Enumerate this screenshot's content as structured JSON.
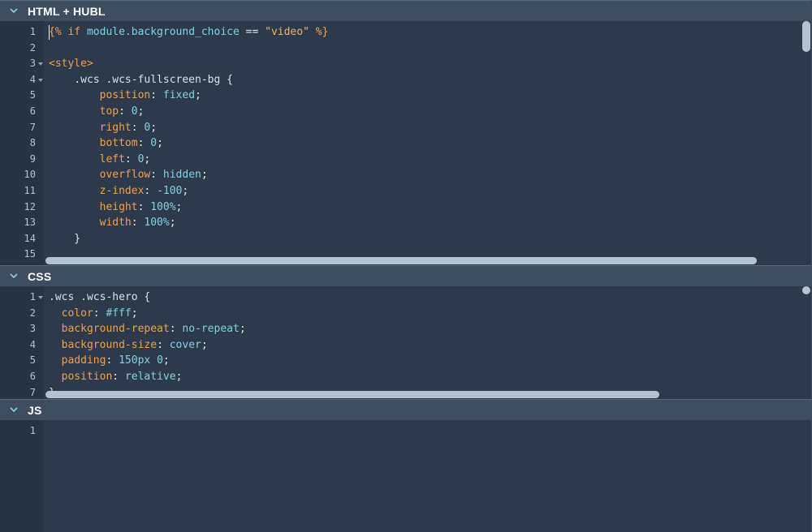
{
  "panels": {
    "html": {
      "title": "HTML + HUBL",
      "lines": [
        {
          "n": "1",
          "tokens": [
            [
              "t-hubl",
              "{% "
            ],
            [
              "t-kw",
              "if "
            ],
            [
              "t-var",
              "module.background_choice "
            ],
            [
              "t-punc",
              "== "
            ],
            [
              "t-str",
              "\"video\" "
            ],
            [
              "t-hubl",
              "%}"
            ]
          ]
        },
        {
          "n": "2",
          "tokens": []
        },
        {
          "n": "3",
          "fold": true,
          "tokens": [
            [
              "t-tag",
              "<style>"
            ]
          ]
        },
        {
          "n": "4",
          "fold": true,
          "tokens": [
            [
              "t-sel",
              "    .wcs .wcs-fullscreen-bg "
            ],
            [
              "t-punc",
              "{"
            ]
          ]
        },
        {
          "n": "5",
          "tokens": [
            [
              "t-prop",
              "        position"
            ],
            [
              "t-punc",
              ": "
            ],
            [
              "t-val",
              "fixed"
            ],
            [
              "t-punc",
              ";"
            ]
          ]
        },
        {
          "n": "6",
          "tokens": [
            [
              "t-prop",
              "        top"
            ],
            [
              "t-punc",
              ": "
            ],
            [
              "t-val",
              "0"
            ],
            [
              "t-punc",
              ";"
            ]
          ]
        },
        {
          "n": "7",
          "tokens": [
            [
              "t-prop",
              "        right"
            ],
            [
              "t-punc",
              ": "
            ],
            [
              "t-val",
              "0"
            ],
            [
              "t-punc",
              ";"
            ]
          ]
        },
        {
          "n": "8",
          "tokens": [
            [
              "t-prop",
              "        bottom"
            ],
            [
              "t-punc",
              ": "
            ],
            [
              "t-val",
              "0"
            ],
            [
              "t-punc",
              ";"
            ]
          ]
        },
        {
          "n": "9",
          "tokens": [
            [
              "t-prop",
              "        left"
            ],
            [
              "t-punc",
              ": "
            ],
            [
              "t-val",
              "0"
            ],
            [
              "t-punc",
              ";"
            ]
          ]
        },
        {
          "n": "10",
          "tokens": [
            [
              "t-prop",
              "        overflow"
            ],
            [
              "t-punc",
              ": "
            ],
            [
              "t-val",
              "hidden"
            ],
            [
              "t-punc",
              ";"
            ]
          ]
        },
        {
          "n": "11",
          "tokens": [
            [
              "t-prop",
              "        z-index"
            ],
            [
              "t-punc",
              ": "
            ],
            [
              "t-val",
              "-100"
            ],
            [
              "t-punc",
              ";"
            ]
          ]
        },
        {
          "n": "12",
          "tokens": [
            [
              "t-prop",
              "        height"
            ],
            [
              "t-punc",
              ": "
            ],
            [
              "t-val",
              "100%"
            ],
            [
              "t-punc",
              ";"
            ]
          ]
        },
        {
          "n": "13",
          "tokens": [
            [
              "t-prop",
              "        width"
            ],
            [
              "t-punc",
              ": "
            ],
            [
              "t-val",
              "100%"
            ],
            [
              "t-punc",
              ";"
            ]
          ]
        },
        {
          "n": "14",
          "tokens": [
            [
              "t-punc",
              "    }"
            ]
          ]
        },
        {
          "n": "15",
          "tokens": []
        }
      ]
    },
    "css": {
      "title": "CSS",
      "lines": [
        {
          "n": "1",
          "fold": true,
          "tokens": [
            [
              "t-sel",
              ".wcs .wcs-hero "
            ],
            [
              "t-punc",
              "{"
            ]
          ]
        },
        {
          "n": "2",
          "tokens": [
            [
              "t-prop",
              "  color"
            ],
            [
              "t-punc",
              ": "
            ],
            [
              "t-val",
              "#fff"
            ],
            [
              "t-punc",
              ";"
            ]
          ]
        },
        {
          "n": "3",
          "tokens": [
            [
              "t-prop",
              "  background-repeat"
            ],
            [
              "t-punc",
              ": "
            ],
            [
              "t-val",
              "no-repeat"
            ],
            [
              "t-punc",
              ";"
            ]
          ]
        },
        {
          "n": "4",
          "tokens": [
            [
              "t-prop",
              "  background-size"
            ],
            [
              "t-punc",
              ": "
            ],
            [
              "t-val",
              "cover"
            ],
            [
              "t-punc",
              ";"
            ]
          ]
        },
        {
          "n": "5",
          "tokens": [
            [
              "t-prop",
              "  padding"
            ],
            [
              "t-punc",
              ": "
            ],
            [
              "t-val",
              "150px 0"
            ],
            [
              "t-punc",
              ";"
            ]
          ]
        },
        {
          "n": "6",
          "tokens": [
            [
              "t-prop",
              "  position"
            ],
            [
              "t-punc",
              ": "
            ],
            [
              "t-val",
              "relative"
            ],
            [
              "t-punc",
              ";"
            ]
          ]
        },
        {
          "n": "7",
          "tokens": [
            [
              "t-punc",
              "}"
            ]
          ]
        }
      ]
    },
    "js": {
      "title": "JS",
      "lines": [
        {
          "n": "1",
          "tokens": []
        }
      ]
    }
  },
  "icons": {
    "collapse": "chevron-down-icon",
    "fold": "fold-triangle-icon"
  },
  "colors": {
    "editor_bg": "#2c3a4c",
    "header_bg": "#3e4e60",
    "keyword": "#f0a14a",
    "value": "#7fd3e0"
  }
}
